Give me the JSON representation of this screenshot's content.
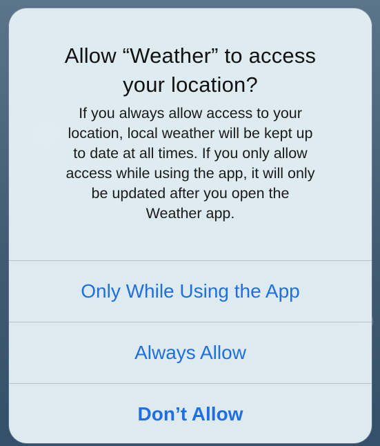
{
  "alert": {
    "title_line1": "Allow “Weather” to access",
    "title_line2": "your location?",
    "message_lines": [
      "If you always allow access to your",
      "location, local weather will be kept up",
      "to date at all times. If you only allow",
      "access while using the app, it will only",
      "be updated after you open the",
      "Weather app."
    ],
    "actions": [
      {
        "label": "Only While Using the App",
        "style": "default"
      },
      {
        "label": "Always Allow",
        "style": "default"
      },
      {
        "label": "Don’t Allow",
        "style": "preferred"
      }
    ]
  },
  "colors": {
    "action_blue": "#1f6fe0",
    "alert_background": "#e4f0f6",
    "separator": "#b3c3ce",
    "title_text": "#111111"
  }
}
